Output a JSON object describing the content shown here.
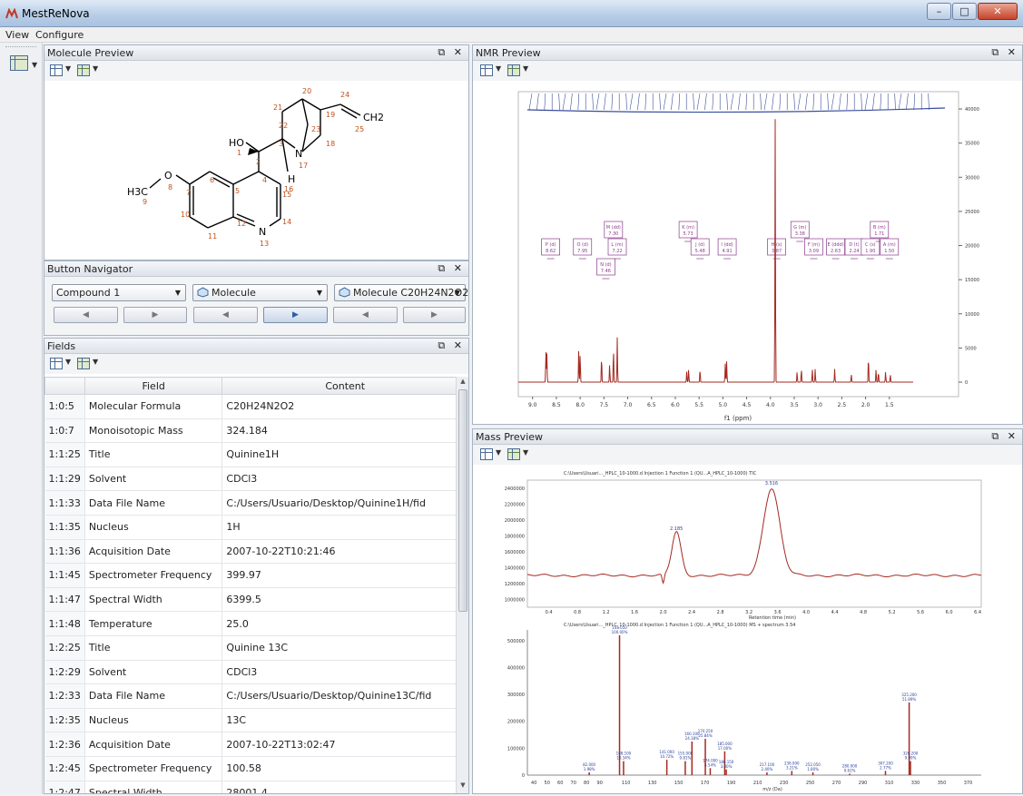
{
  "window": {
    "title": "MestReNova"
  },
  "menu": [
    "View",
    "Configure"
  ],
  "panels": {
    "molecule_preview": "Molecule Preview",
    "nmr_preview": "NMR Preview",
    "button_navigator": "Button Navigator",
    "fields": "Fields",
    "mass_preview": "Mass Preview"
  },
  "molecule": {
    "labels": {
      "ho": "HO",
      "ch2": "CH2",
      "h3c": "H3C",
      "o": "O",
      "n": "N",
      "h": "H",
      "n17": "N"
    },
    "numbers": [
      "1",
      "2",
      "3",
      "4",
      "5",
      "6",
      "7",
      "8",
      "9",
      "10",
      "11",
      "12",
      "13",
      "14",
      "15",
      "16",
      "17",
      "18",
      "19",
      "20",
      "21",
      "22",
      "23",
      "24",
      "25"
    ]
  },
  "navigator": {
    "compound": "Compound 1",
    "type": "Molecule",
    "item": "Molecule C20H24N2O2"
  },
  "fields": {
    "headers": [
      "Field",
      "Content"
    ],
    "rows": [
      {
        "id": "1:0:5",
        "field": "Molecular Formula",
        "content": "C20H24N2O2"
      },
      {
        "id": "1:0:7",
        "field": "Monoisotopic Mass",
        "content": "324.184"
      },
      {
        "id": "1:1:25",
        "field": "Title",
        "content": "Quinine1H"
      },
      {
        "id": "1:1:29",
        "field": "Solvent",
        "content": "CDCl3"
      },
      {
        "id": "1:1:33",
        "field": "Data File Name",
        "content": "C:/Users/Usuario/Desktop/Quinine1H/fid"
      },
      {
        "id": "1:1:35",
        "field": "Nucleus",
        "content": "1H"
      },
      {
        "id": "1:1:36",
        "field": "Acquisition Date",
        "content": "2007-10-22T10:21:46"
      },
      {
        "id": "1:1:45",
        "field": "Spectrometer Frequency",
        "content": "399.97"
      },
      {
        "id": "1:1:47",
        "field": "Spectral Width",
        "content": "6399.5"
      },
      {
        "id": "1:1:48",
        "field": "Temperature",
        "content": "25.0"
      },
      {
        "id": "1:2:25",
        "field": "Title",
        "content": "Quinine 13C"
      },
      {
        "id": "1:2:29",
        "field": "Solvent",
        "content": "CDCl3"
      },
      {
        "id": "1:2:33",
        "field": "Data File Name",
        "content": "C:/Users/Usuario/Desktop/Quinine13C/fid"
      },
      {
        "id": "1:2:35",
        "field": "Nucleus",
        "content": "13C"
      },
      {
        "id": "1:2:36",
        "field": "Acquisition Date",
        "content": "2007-10-22T13:02:47"
      },
      {
        "id": "1:2:45",
        "field": "Spectrometer Frequency",
        "content": "100.58"
      },
      {
        "id": "1:2:47",
        "field": "Spectral Width",
        "content": "28001.4"
      }
    ]
  },
  "nmr": {
    "xlabel": "f1 (ppm)",
    "xticks": [
      "9.0",
      "8.5",
      "8.0",
      "7.5",
      "7.0",
      "6.5",
      "6.0",
      "5.5",
      "5.0",
      "4.5",
      "4.0",
      "3.5",
      "3.0",
      "2.5",
      "2.0",
      "1.5"
    ],
    "yticks": [
      "40000",
      "35000",
      "30000",
      "25000",
      "20000",
      "15000",
      "10000",
      "5000",
      "0"
    ],
    "multiplets": [
      {
        "label": "P (d)",
        "value": "8.62",
        "ppm": 8.62
      },
      {
        "label": "O (d)",
        "value": "7.95",
        "ppm": 7.95
      },
      {
        "label": "M (dd)",
        "value": "7.30",
        "ppm": 7.3
      },
      {
        "label": "L (m)",
        "value": "7.22",
        "ppm": 7.22
      },
      {
        "label": "N (d)",
        "value": "7.46",
        "ppm": 7.46
      },
      {
        "label": "K (m)",
        "value": "5.73",
        "ppm": 5.73
      },
      {
        "label": "J (d)",
        "value": "5.48",
        "ppm": 5.48
      },
      {
        "label": "I (dd)",
        "value": "4.91",
        "ppm": 4.91
      },
      {
        "label": "H (s)",
        "value": "3.87",
        "ppm": 3.87
      },
      {
        "label": "G (m)",
        "value": "3.38",
        "ppm": 3.38
      },
      {
        "label": "F (m)",
        "value": "3.09",
        "ppm": 3.09
      },
      {
        "label": "E (ddd)",
        "value": "2.63",
        "ppm": 2.63
      },
      {
        "label": "D (t)",
        "value": "2.24",
        "ppm": 2.24
      },
      {
        "label": "C (s)",
        "value": "1.90",
        "ppm": 1.9
      },
      {
        "label": "B (m)",
        "value": "1.71",
        "ppm": 1.71
      },
      {
        "label": "A (m)",
        "value": "1.50",
        "ppm": 1.5
      }
    ]
  },
  "mass": {
    "tic_title": "C:\\Users\\Usuari..._HPLC_10-1000.d Injection 1 Function 1 (QU...A_HPLC_10-1000) TIC",
    "tic_xlabel": "Retention time (min)",
    "tic_xticks": [
      "0.4",
      "0.8",
      "1.2",
      "1.6",
      "2.0",
      "2.4",
      "2.8",
      "3.2",
      "3.6",
      "4.0",
      "4.4",
      "4.8",
      "5.2",
      "5.6",
      "6.0",
      "6.4"
    ],
    "tic_yticks": [
      "2400000",
      "2200000",
      "2000000",
      "1800000",
      "1600000",
      "1400000",
      "1200000",
      "1000000"
    ],
    "tic_peaks": [
      {
        "label": "2.185",
        "rt": 2.185
      },
      {
        "label": "3.516",
        "rt": 3.516
      }
    ],
    "ms_title": "C:\\Users\\Usuari..._HPLC_10-1000.d Injection 1 Function 1 (QU...A_HPLC_10-1000) MS + spectrum 3.54",
    "ms_xlabel": "m/z (Da)",
    "ms_xticks": [
      "40",
      "50",
      "60",
      "70",
      "80",
      "90",
      "110",
      "130",
      "150",
      "170",
      "190",
      "210",
      "230",
      "250",
      "270",
      "290",
      "310",
      "330",
      "350",
      "370"
    ],
    "ms_yticks": [
      "500000",
      "400000",
      "300000",
      "200000",
      "100000",
      "0"
    ],
    "ms_peaks": [
      {
        "mz": 105.05,
        "label": "105.050",
        "pct": "100.00%",
        "rel": 100
      },
      {
        "mz": 82.0,
        "label": "82.000",
        "pct": "1.98%",
        "rel": 2
      },
      {
        "mz": 108.1,
        "label": "108.100",
        "pct": "10.34%",
        "rel": 10
      },
      {
        "mz": 141.0,
        "label": "141.000",
        "pct": "10.72%",
        "rel": 11
      },
      {
        "mz": 155.0,
        "label": "155.000",
        "pct": "9.81%",
        "rel": 10
      },
      {
        "mz": 160.1,
        "label": "160.100",
        "pct": "24.38%",
        "rel": 24
      },
      {
        "mz": 170.25,
        "label": "170.250",
        "pct": "25.84%",
        "rel": 26
      },
      {
        "mz": 174.0,
        "label": "174.000",
        "pct": "4.54%",
        "rel": 5
      },
      {
        "mz": 185.0,
        "label": "185.000",
        "pct": "17.00%",
        "rel": 17
      },
      {
        "mz": 186.15,
        "label": "186.150",
        "pct": "3.80%",
        "rel": 4
      },
      {
        "mz": 217.1,
        "label": "217.100",
        "pct": "2.40%",
        "rel": 2
      },
      {
        "mz": 236.0,
        "label": "236.000",
        "pct": "3.21%",
        "rel": 3
      },
      {
        "mz": 252.05,
        "label": "252.050",
        "pct": "1.80%",
        "rel": 2
      },
      {
        "mz": 280.0,
        "label": "280.000",
        "pct": "0.62%",
        "rel": 1
      },
      {
        "mz": 307.2,
        "label": "307.200",
        "pct": "2.77%",
        "rel": 3
      },
      {
        "mz": 325.2,
        "label": "325.200",
        "pct": "51.89%",
        "rel": 52
      },
      {
        "mz": 326.2,
        "label": "326.200",
        "pct": "9.99%",
        "rel": 10
      }
    ]
  },
  "colors": {
    "spectrum": "#a32a22",
    "peak_label": "#2a3f9a",
    "multiplet": "#8a3a8a",
    "accent": "#2a5ea8"
  }
}
